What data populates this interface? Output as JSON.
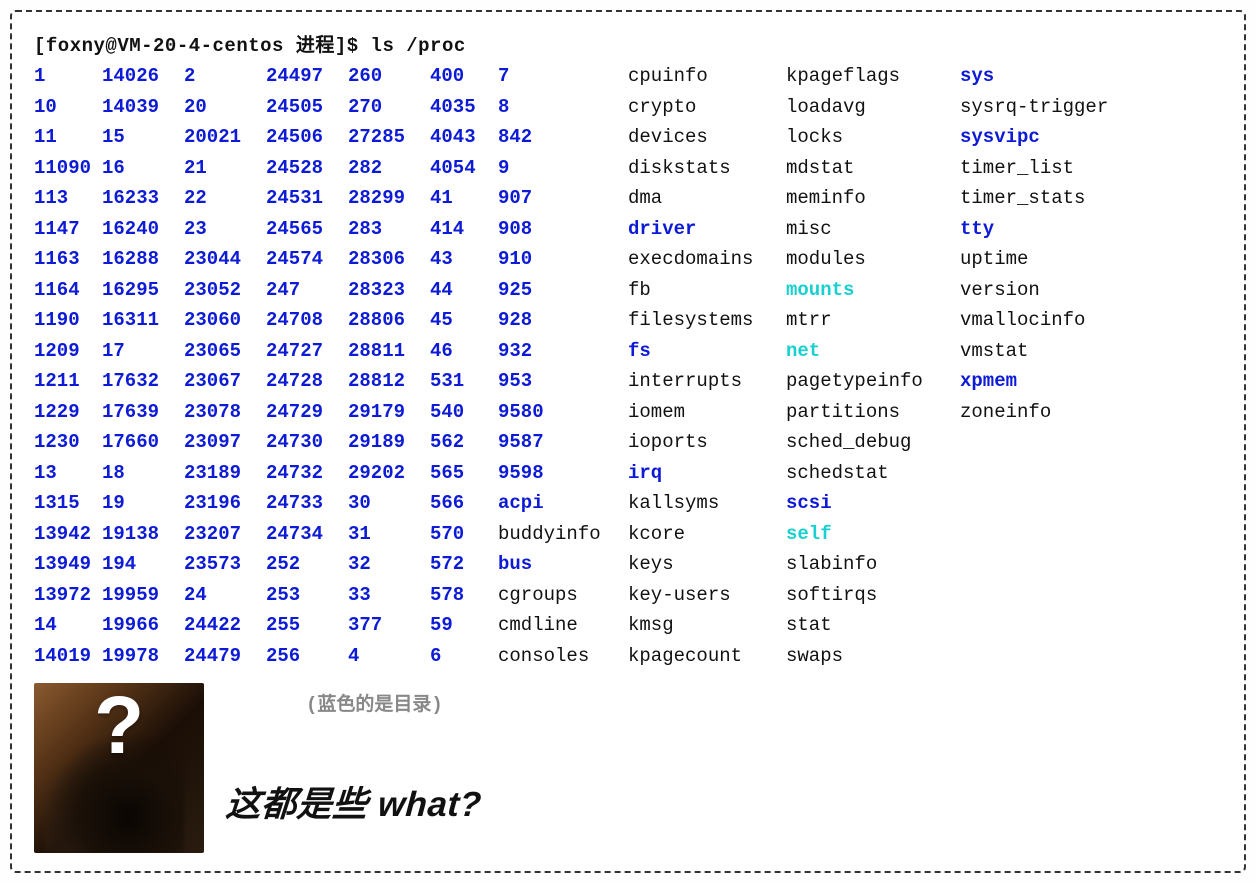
{
  "prompt": "[foxny@VM-20-4-centos 进程]$ ls /proc",
  "entries": [
    {
      "t": "1",
      "c": "dir"
    },
    {
      "t": "14026",
      "c": "dir"
    },
    {
      "t": "2",
      "c": "dir"
    },
    {
      "t": "24497",
      "c": "dir"
    },
    {
      "t": "260",
      "c": "dir"
    },
    {
      "t": "400",
      "c": "dir"
    },
    {
      "t": "7",
      "c": "dir"
    },
    {
      "t": "cpuinfo",
      "c": "file"
    },
    {
      "t": "kpageflags",
      "c": "file"
    },
    {
      "t": "sys",
      "c": "dir"
    },
    {
      "t": "10",
      "c": "dir"
    },
    {
      "t": "14039",
      "c": "dir"
    },
    {
      "t": "20",
      "c": "dir"
    },
    {
      "t": "24505",
      "c": "dir"
    },
    {
      "t": "270",
      "c": "dir"
    },
    {
      "t": "4035",
      "c": "dir"
    },
    {
      "t": "8",
      "c": "dir"
    },
    {
      "t": "crypto",
      "c": "file"
    },
    {
      "t": "loadavg",
      "c": "file"
    },
    {
      "t": "sysrq-trigger",
      "c": "file"
    },
    {
      "t": "11",
      "c": "dir"
    },
    {
      "t": "15",
      "c": "dir"
    },
    {
      "t": "20021",
      "c": "dir"
    },
    {
      "t": "24506",
      "c": "dir"
    },
    {
      "t": "27285",
      "c": "dir"
    },
    {
      "t": "4043",
      "c": "dir"
    },
    {
      "t": "842",
      "c": "dir"
    },
    {
      "t": "devices",
      "c": "file"
    },
    {
      "t": "locks",
      "c": "file"
    },
    {
      "t": "sysvipc",
      "c": "dir"
    },
    {
      "t": "11090",
      "c": "dir"
    },
    {
      "t": "16",
      "c": "dir"
    },
    {
      "t": "21",
      "c": "dir"
    },
    {
      "t": "24528",
      "c": "dir"
    },
    {
      "t": "282",
      "c": "dir"
    },
    {
      "t": "4054",
      "c": "dir"
    },
    {
      "t": "9",
      "c": "dir"
    },
    {
      "t": "diskstats",
      "c": "file"
    },
    {
      "t": "mdstat",
      "c": "file"
    },
    {
      "t": "timer_list",
      "c": "file"
    },
    {
      "t": "113",
      "c": "dir"
    },
    {
      "t": "16233",
      "c": "dir"
    },
    {
      "t": "22",
      "c": "dir"
    },
    {
      "t": "24531",
      "c": "dir"
    },
    {
      "t": "28299",
      "c": "dir"
    },
    {
      "t": "41",
      "c": "dir"
    },
    {
      "t": "907",
      "c": "dir"
    },
    {
      "t": "dma",
      "c": "file"
    },
    {
      "t": "meminfo",
      "c": "file"
    },
    {
      "t": "timer_stats",
      "c": "file"
    },
    {
      "t": "1147",
      "c": "dir"
    },
    {
      "t": "16240",
      "c": "dir"
    },
    {
      "t": "23",
      "c": "dir"
    },
    {
      "t": "24565",
      "c": "dir"
    },
    {
      "t": "283",
      "c": "dir"
    },
    {
      "t": "414",
      "c": "dir"
    },
    {
      "t": "908",
      "c": "dir"
    },
    {
      "t": "driver",
      "c": "dir"
    },
    {
      "t": "misc",
      "c": "file"
    },
    {
      "t": "tty",
      "c": "dir"
    },
    {
      "t": "1163",
      "c": "dir"
    },
    {
      "t": "16288",
      "c": "dir"
    },
    {
      "t": "23044",
      "c": "dir"
    },
    {
      "t": "24574",
      "c": "dir"
    },
    {
      "t": "28306",
      "c": "dir"
    },
    {
      "t": "43",
      "c": "dir"
    },
    {
      "t": "910",
      "c": "dir"
    },
    {
      "t": "execdomains",
      "c": "file"
    },
    {
      "t": "modules",
      "c": "file"
    },
    {
      "t": "uptime",
      "c": "file"
    },
    {
      "t": "1164",
      "c": "dir"
    },
    {
      "t": "16295",
      "c": "dir"
    },
    {
      "t": "23052",
      "c": "dir"
    },
    {
      "t": "247",
      "c": "dir"
    },
    {
      "t": "28323",
      "c": "dir"
    },
    {
      "t": "44",
      "c": "dir"
    },
    {
      "t": "925",
      "c": "dir"
    },
    {
      "t": "fb",
      "c": "file"
    },
    {
      "t": "mounts",
      "c": "symlink"
    },
    {
      "t": "version",
      "c": "file"
    },
    {
      "t": "1190",
      "c": "dir"
    },
    {
      "t": "16311",
      "c": "dir"
    },
    {
      "t": "23060",
      "c": "dir"
    },
    {
      "t": "24708",
      "c": "dir"
    },
    {
      "t": "28806",
      "c": "dir"
    },
    {
      "t": "45",
      "c": "dir"
    },
    {
      "t": "928",
      "c": "dir"
    },
    {
      "t": "filesystems",
      "c": "file"
    },
    {
      "t": "mtrr",
      "c": "file"
    },
    {
      "t": "vmallocinfo",
      "c": "file"
    },
    {
      "t": "1209",
      "c": "dir"
    },
    {
      "t": "17",
      "c": "dir"
    },
    {
      "t": "23065",
      "c": "dir"
    },
    {
      "t": "24727",
      "c": "dir"
    },
    {
      "t": "28811",
      "c": "dir"
    },
    {
      "t": "46",
      "c": "dir"
    },
    {
      "t": "932",
      "c": "dir"
    },
    {
      "t": "fs",
      "c": "dir"
    },
    {
      "t": "net",
      "c": "symlink"
    },
    {
      "t": "vmstat",
      "c": "file"
    },
    {
      "t": "1211",
      "c": "dir"
    },
    {
      "t": "17632",
      "c": "dir"
    },
    {
      "t": "23067",
      "c": "dir"
    },
    {
      "t": "24728",
      "c": "dir"
    },
    {
      "t": "28812",
      "c": "dir"
    },
    {
      "t": "531",
      "c": "dir"
    },
    {
      "t": "953",
      "c": "dir"
    },
    {
      "t": "interrupts",
      "c": "file"
    },
    {
      "t": "pagetypeinfo",
      "c": "file"
    },
    {
      "t": "xpmem",
      "c": "dir"
    },
    {
      "t": "1229",
      "c": "dir"
    },
    {
      "t": "17639",
      "c": "dir"
    },
    {
      "t": "23078",
      "c": "dir"
    },
    {
      "t": "24729",
      "c": "dir"
    },
    {
      "t": "29179",
      "c": "dir"
    },
    {
      "t": "540",
      "c": "dir"
    },
    {
      "t": "9580",
      "c": "dir"
    },
    {
      "t": "iomem",
      "c": "file"
    },
    {
      "t": "partitions",
      "c": "file"
    },
    {
      "t": "zoneinfo",
      "c": "file"
    },
    {
      "t": "1230",
      "c": "dir"
    },
    {
      "t": "17660",
      "c": "dir"
    },
    {
      "t": "23097",
      "c": "dir"
    },
    {
      "t": "24730",
      "c": "dir"
    },
    {
      "t": "29189",
      "c": "dir"
    },
    {
      "t": "562",
      "c": "dir"
    },
    {
      "t": "9587",
      "c": "dir"
    },
    {
      "t": "ioports",
      "c": "file"
    },
    {
      "t": "sched_debug",
      "c": "file"
    },
    {
      "t": "",
      "c": "file"
    },
    {
      "t": "13",
      "c": "dir"
    },
    {
      "t": "18",
      "c": "dir"
    },
    {
      "t": "23189",
      "c": "dir"
    },
    {
      "t": "24732",
      "c": "dir"
    },
    {
      "t": "29202",
      "c": "dir"
    },
    {
      "t": "565",
      "c": "dir"
    },
    {
      "t": "9598",
      "c": "dir"
    },
    {
      "t": "irq",
      "c": "dir"
    },
    {
      "t": "schedstat",
      "c": "file"
    },
    {
      "t": "",
      "c": "file"
    },
    {
      "t": "1315",
      "c": "dir"
    },
    {
      "t": "19",
      "c": "dir"
    },
    {
      "t": "23196",
      "c": "dir"
    },
    {
      "t": "24733",
      "c": "dir"
    },
    {
      "t": "30",
      "c": "dir"
    },
    {
      "t": "566",
      "c": "dir"
    },
    {
      "t": "acpi",
      "c": "dir"
    },
    {
      "t": "kallsyms",
      "c": "file"
    },
    {
      "t": "scsi",
      "c": "dir"
    },
    {
      "t": "",
      "c": "file"
    },
    {
      "t": "13942",
      "c": "dir"
    },
    {
      "t": "19138",
      "c": "dir"
    },
    {
      "t": "23207",
      "c": "dir"
    },
    {
      "t": "24734",
      "c": "dir"
    },
    {
      "t": "31",
      "c": "dir"
    },
    {
      "t": "570",
      "c": "dir"
    },
    {
      "t": "buddyinfo",
      "c": "file"
    },
    {
      "t": "kcore",
      "c": "file"
    },
    {
      "t": "self",
      "c": "symlink"
    },
    {
      "t": "",
      "c": "file"
    },
    {
      "t": "13949",
      "c": "dir"
    },
    {
      "t": "194",
      "c": "dir"
    },
    {
      "t": "23573",
      "c": "dir"
    },
    {
      "t": "252",
      "c": "dir"
    },
    {
      "t": "32",
      "c": "dir"
    },
    {
      "t": "572",
      "c": "dir"
    },
    {
      "t": "bus",
      "c": "dir"
    },
    {
      "t": "keys",
      "c": "file"
    },
    {
      "t": "slabinfo",
      "c": "file"
    },
    {
      "t": "",
      "c": "file"
    },
    {
      "t": "13972",
      "c": "dir"
    },
    {
      "t": "19959",
      "c": "dir"
    },
    {
      "t": "24",
      "c": "dir"
    },
    {
      "t": "253",
      "c": "dir"
    },
    {
      "t": "33",
      "c": "dir"
    },
    {
      "t": "578",
      "c": "dir"
    },
    {
      "t": "cgroups",
      "c": "file"
    },
    {
      "t": "key-users",
      "c": "file"
    },
    {
      "t": "softirqs",
      "c": "file"
    },
    {
      "t": "",
      "c": "file"
    },
    {
      "t": "14",
      "c": "dir"
    },
    {
      "t": "19966",
      "c": "dir"
    },
    {
      "t": "24422",
      "c": "dir"
    },
    {
      "t": "255",
      "c": "dir"
    },
    {
      "t": "377",
      "c": "dir"
    },
    {
      "t": "59",
      "c": "dir"
    },
    {
      "t": "cmdline",
      "c": "file"
    },
    {
      "t": "kmsg",
      "c": "file"
    },
    {
      "t": "stat",
      "c": "file"
    },
    {
      "t": "",
      "c": "file"
    },
    {
      "t": "14019",
      "c": "dir"
    },
    {
      "t": "19978",
      "c": "dir"
    },
    {
      "t": "24479",
      "c": "dir"
    },
    {
      "t": "256",
      "c": "dir"
    },
    {
      "t": "4",
      "c": "dir"
    },
    {
      "t": "6",
      "c": "dir"
    },
    {
      "t": "consoles",
      "c": "file"
    },
    {
      "t": "kpagecount",
      "c": "file"
    },
    {
      "t": "swaps",
      "c": "file"
    },
    {
      "t": "",
      "c": "file"
    }
  ],
  "note": "(蓝色的是目录)",
  "caption": "这都是些 what?",
  "qmark": "?"
}
